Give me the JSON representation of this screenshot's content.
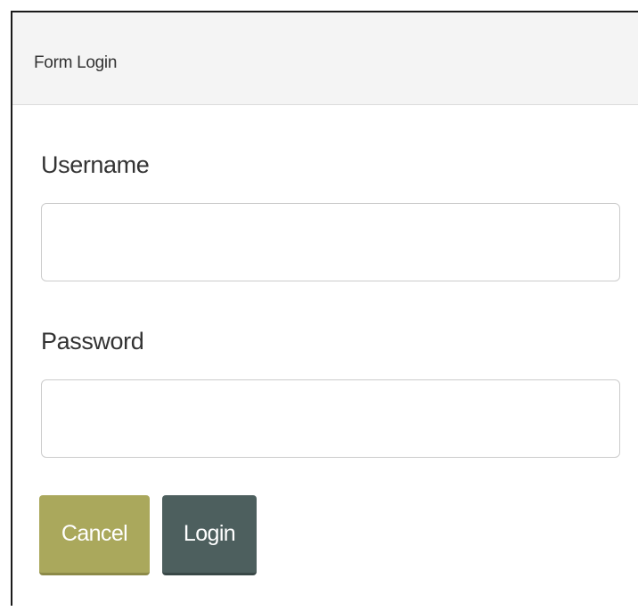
{
  "panel": {
    "title": "Form Login"
  },
  "form": {
    "username": {
      "label": "Username",
      "value": "",
      "placeholder": ""
    },
    "password": {
      "label": "Password",
      "value": "",
      "placeholder": ""
    }
  },
  "buttons": {
    "cancel_label": "Cancel",
    "login_label": "Login"
  },
  "colors": {
    "cancel_button": "#aaa85c",
    "login_button": "#4d5f5e",
    "heading_background": "#f4f4f4"
  }
}
